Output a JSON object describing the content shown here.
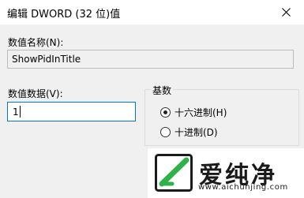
{
  "window": {
    "title": "编辑 DWORD (32 位)值"
  },
  "value_name": {
    "label": "数值名称(N):",
    "value": "ShowPidInTitle"
  },
  "value_data": {
    "label": "数值数据(V):",
    "value": "1"
  },
  "base": {
    "title": "基数",
    "options": [
      {
        "label": "十六进制(H)",
        "selected": true
      },
      {
        "label": "十进制(D)",
        "selected": false
      }
    ]
  },
  "watermark": {
    "brand": "爱纯净",
    "url": "www.aichunjing.com",
    "accent": "#2fb24a"
  }
}
